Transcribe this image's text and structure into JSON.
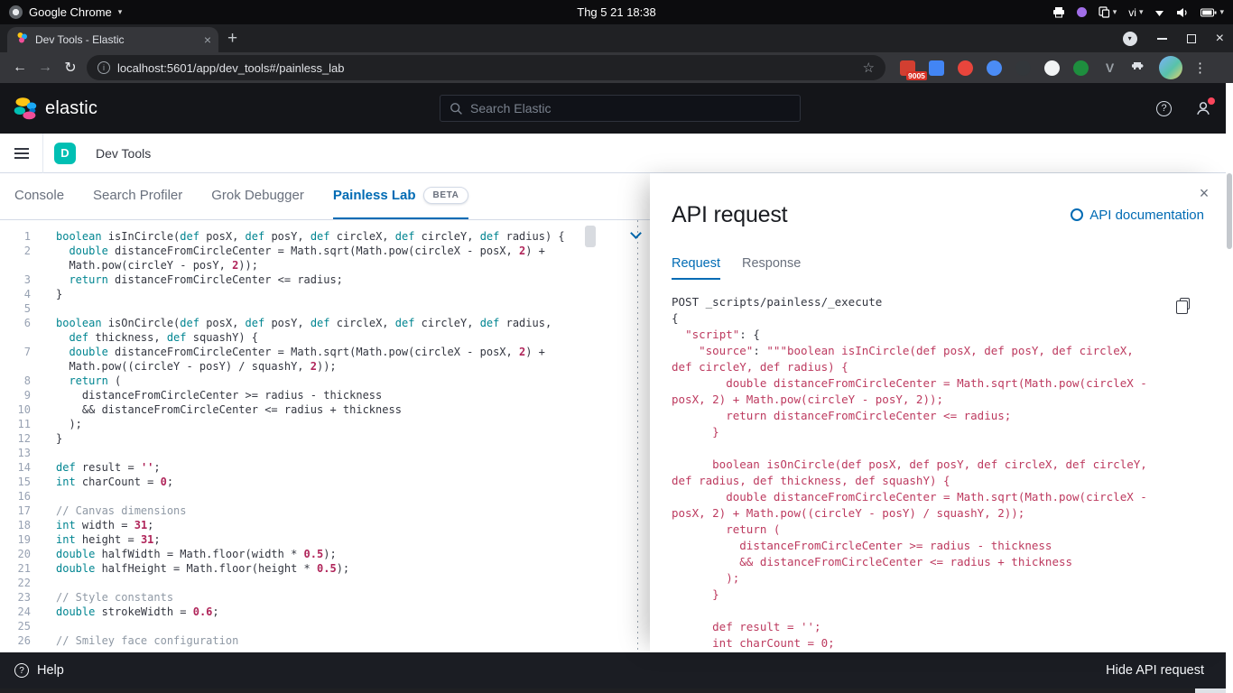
{
  "os_bar": {
    "app_name": "Google Chrome",
    "clock": "Thg 5 21 18:38",
    "keyboard_layout": "vi"
  },
  "browser": {
    "tab_title": "Dev Tools - Elastic",
    "url": "localhost:5601/app/dev_tools#/painless_lab",
    "extensions": [
      {
        "name": "extension-icon-red",
        "shape": "square",
        "color": "#d23f31",
        "badge": "9005"
      },
      {
        "name": "extension-icon-blue",
        "shape": "square",
        "color": "#4285f4"
      },
      {
        "name": "extension-icon-crimson",
        "shape": "circle",
        "color": "#e8453c"
      },
      {
        "name": "extension-icon-multicolor",
        "shape": "circle",
        "color": "#4b8cf5"
      },
      {
        "name": "extension-icon-dark",
        "shape": "circle",
        "color": "#33373b"
      },
      {
        "name": "extension-icon-white",
        "shape": "circle",
        "color": "#f1f3f4"
      },
      {
        "name": "extension-icon-green",
        "shape": "circle",
        "color": "#1e8e3e"
      },
      {
        "name": "extension-icon-letter-v",
        "shape": "letter",
        "color": "#9aa0a6",
        "letter": "V"
      }
    ]
  },
  "kibana": {
    "brand": "elastic",
    "search_placeholder": "Search Elastic",
    "space_initial": "D",
    "breadcrumb": "Dev Tools",
    "nav_tabs": [
      {
        "label": "Console",
        "active": false
      },
      {
        "label": "Search Profiler",
        "active": false
      },
      {
        "label": "Grok Debugger",
        "active": false
      },
      {
        "label": "Painless Lab",
        "active": true,
        "badge": "BETA"
      }
    ]
  },
  "editor": {
    "lines": [
      {
        "n": "1",
        "tokens": [
          [
            "k",
            "boolean"
          ],
          [
            "t",
            " isInCircle("
          ],
          [
            "k",
            "def"
          ],
          [
            "t",
            " posX, "
          ],
          [
            "k",
            "def"
          ],
          [
            "t",
            " posY, "
          ],
          [
            "k",
            "def"
          ],
          [
            "t",
            " circleX, "
          ],
          [
            "k",
            "def"
          ],
          [
            "t",
            " circleY, "
          ],
          [
            "k",
            "def"
          ],
          [
            "t",
            " radius) {"
          ]
        ]
      },
      {
        "n": "2",
        "tokens": [
          [
            "t",
            "  "
          ],
          [
            "k",
            "double"
          ],
          [
            "t",
            " distanceFromCircleCenter = Math.sqrt(Math.pow(circleX - posX, "
          ],
          [
            "n",
            "2"
          ],
          [
            "t",
            ") + Math.pow(circleY - posY, "
          ],
          [
            "n",
            "2"
          ],
          [
            "t",
            "));"
          ]
        ]
      },
      {
        "n": "3",
        "tokens": [
          [
            "t",
            "  "
          ],
          [
            "k",
            "return"
          ],
          [
            "t",
            " distanceFromCircleCenter <= radius;"
          ]
        ]
      },
      {
        "n": "4",
        "tokens": [
          [
            "t",
            "}"
          ]
        ]
      },
      {
        "n": "5",
        "tokens": []
      },
      {
        "n": "6",
        "tokens": [
          [
            "k",
            "boolean"
          ],
          [
            "t",
            " isOnCircle("
          ],
          [
            "k",
            "def"
          ],
          [
            "t",
            " posX, "
          ],
          [
            "k",
            "def"
          ],
          [
            "t",
            " posY, "
          ],
          [
            "k",
            "def"
          ],
          [
            "t",
            " circleX, "
          ],
          [
            "k",
            "def"
          ],
          [
            "t",
            " circleY, "
          ],
          [
            "k",
            "def"
          ],
          [
            "t",
            " radius, "
          ],
          [
            "k",
            "def"
          ],
          [
            "t",
            " thickness, "
          ],
          [
            "k",
            "def"
          ],
          [
            "t",
            " squashY) {"
          ]
        ]
      },
      {
        "n": "7",
        "tokens": [
          [
            "t",
            "  "
          ],
          [
            "k",
            "double"
          ],
          [
            "t",
            " distanceFromCircleCenter = Math.sqrt(Math.pow(circleX - posX, "
          ],
          [
            "n",
            "2"
          ],
          [
            "t",
            ") + Math.pow((circleY - posY) / squashY, "
          ],
          [
            "n",
            "2"
          ],
          [
            "t",
            "));"
          ]
        ]
      },
      {
        "n": "8",
        "tokens": [
          [
            "t",
            "  "
          ],
          [
            "k",
            "return"
          ],
          [
            "t",
            " ("
          ]
        ]
      },
      {
        "n": "9",
        "tokens": [
          [
            "t",
            "    distanceFromCircleCenter >= radius - thickness"
          ]
        ]
      },
      {
        "n": "10",
        "tokens": [
          [
            "t",
            "    && distanceFromCircleCenter <= radius + thickness"
          ]
        ]
      },
      {
        "n": "11",
        "tokens": [
          [
            "t",
            "  );"
          ]
        ]
      },
      {
        "n": "12",
        "tokens": [
          [
            "t",
            "}"
          ]
        ]
      },
      {
        "n": "13",
        "tokens": []
      },
      {
        "n": "14",
        "tokens": [
          [
            "k",
            "def"
          ],
          [
            "t",
            " result = "
          ],
          [
            "n",
            "''"
          ],
          [
            "t",
            ";"
          ]
        ]
      },
      {
        "n": "15",
        "tokens": [
          [
            "k",
            "int"
          ],
          [
            "t",
            " charCount = "
          ],
          [
            "n",
            "0"
          ],
          [
            "t",
            ";"
          ]
        ]
      },
      {
        "n": "16",
        "tokens": []
      },
      {
        "n": "17",
        "tokens": [
          [
            "c",
            "// Canvas dimensions"
          ]
        ]
      },
      {
        "n": "18",
        "tokens": [
          [
            "k",
            "int"
          ],
          [
            "t",
            " width = "
          ],
          [
            "n",
            "31"
          ],
          [
            "t",
            ";"
          ]
        ]
      },
      {
        "n": "19",
        "tokens": [
          [
            "k",
            "int"
          ],
          [
            "t",
            " height = "
          ],
          [
            "n",
            "31"
          ],
          [
            "t",
            ";"
          ]
        ]
      },
      {
        "n": "20",
        "tokens": [
          [
            "k",
            "double"
          ],
          [
            "t",
            " halfWidth = Math.floor(width * "
          ],
          [
            "n",
            "0.5"
          ],
          [
            "t",
            ");"
          ]
        ]
      },
      {
        "n": "21",
        "tokens": [
          [
            "k",
            "double"
          ],
          [
            "t",
            " halfHeight = Math.floor(height * "
          ],
          [
            "n",
            "0.5"
          ],
          [
            "t",
            ");"
          ]
        ]
      },
      {
        "n": "22",
        "tokens": []
      },
      {
        "n": "23",
        "tokens": [
          [
            "c",
            "// Style constants"
          ]
        ]
      },
      {
        "n": "24",
        "tokens": [
          [
            "k",
            "double"
          ],
          [
            "t",
            " strokeWidth = "
          ],
          [
            "n",
            "0.6"
          ],
          [
            "t",
            ";"
          ]
        ]
      },
      {
        "n": "25",
        "tokens": []
      },
      {
        "n": "26",
        "tokens": [
          [
            "c",
            "// Smiley face configuration"
          ]
        ]
      }
    ]
  },
  "flyout": {
    "title": "API request",
    "doc_link": "API documentation",
    "tabs": [
      {
        "label": "Request",
        "active": true
      },
      {
        "label": "Response",
        "active": false
      }
    ],
    "request_lines": [
      [
        [
          "t",
          "POST _scripts/painless/_execute"
        ]
      ],
      [
        [
          "t",
          "{"
        ]
      ],
      [
        [
          "t",
          "  "
        ],
        [
          "r",
          "\"script\""
        ],
        [
          "t",
          ": {"
        ]
      ],
      [
        [
          "t",
          "    "
        ],
        [
          "r",
          "\"source\""
        ],
        [
          "t",
          ": "
        ],
        [
          "r",
          "\"\"\"boolean isInCircle(def posX, def posY, def circleX, def circleY, def radius) {"
        ]
      ],
      [
        [
          "r",
          "        double distanceFromCircleCenter = Math.sqrt(Math.pow(circleX - posX, 2) + Math.pow(circleY - posY, 2));"
        ]
      ],
      [
        [
          "r",
          "        return distanceFromCircleCenter <= radius;"
        ]
      ],
      [
        [
          "r",
          "      }"
        ]
      ],
      [
        [
          "t",
          ""
        ]
      ],
      [
        [
          "r",
          "      boolean isOnCircle(def posX, def posY, def circleX, def circleY, def radius, def thickness, def squashY) {"
        ]
      ],
      [
        [
          "r",
          "        double distanceFromCircleCenter = Math.sqrt(Math.pow(circleX - posX, 2) + Math.pow((circleY - posY) / squashY, 2));"
        ]
      ],
      [
        [
          "r",
          "        return ("
        ]
      ],
      [
        [
          "r",
          "          distanceFromCircleCenter >= radius - thickness"
        ]
      ],
      [
        [
          "r",
          "          && distanceFromCircleCenter <= radius + thickness"
        ]
      ],
      [
        [
          "r",
          "        );"
        ]
      ],
      [
        [
          "r",
          "      }"
        ]
      ],
      [
        [
          "t",
          ""
        ]
      ],
      [
        [
          "r",
          "      def result = '';"
        ]
      ],
      [
        [
          "r",
          "      int charCount = 0;"
        ]
      ]
    ]
  },
  "footer": {
    "help": "Help",
    "hide_api_request": "Hide API request"
  },
  "icons": {
    "back": "←",
    "forward": "→",
    "reload": "↻",
    "star": "☆",
    "close": "×",
    "plus": "+",
    "overflow": "⋮",
    "caret": "▾",
    "info": "i",
    "question": "?"
  },
  "colors": {
    "accent_blue": "#006BB4",
    "space_avatar": "#00BFB3",
    "badge_red": "#D93025",
    "notification_red": "#FB465C"
  }
}
